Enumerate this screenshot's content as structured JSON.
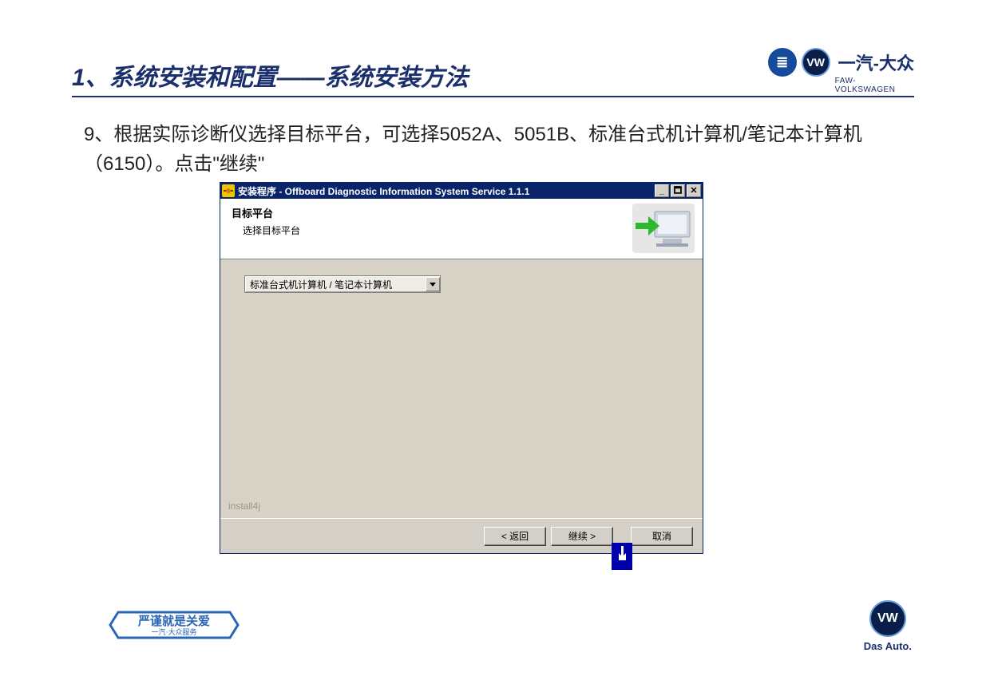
{
  "slide": {
    "title": "1、系统安装和配置——系统安装方法",
    "body_text": "9、根据实际诊断仪选择目标平台，可选择5052A、5051B、标准台式机计算机/笔记本计算机（6150）。点击\"继续\""
  },
  "brand": {
    "top_text": "一汽-大众",
    "top_sub": "FAW-VOLKSWAGEN",
    "faw_glyph": "≣",
    "vw_glyph": "VW",
    "das_auto": "Das Auto.",
    "footer_left_main": "严谨就是关爱",
    "footer_left_sub": "一汽·大众服务"
  },
  "installer": {
    "titlebar": "安装程序 - Offboard Diagnostic Information System Service 1.1.1",
    "header_title": "目标平台",
    "header_sub": "选择目标平台",
    "dropdown_value": "标准台式机计算机 / 笔记本计算机",
    "install4j": "install4j",
    "buttons": {
      "back": "< 返回",
      "next": "继续 >",
      "cancel": "取消"
    },
    "window_controls": {
      "min": "_",
      "restore": "🗖",
      "close": "✕"
    }
  }
}
